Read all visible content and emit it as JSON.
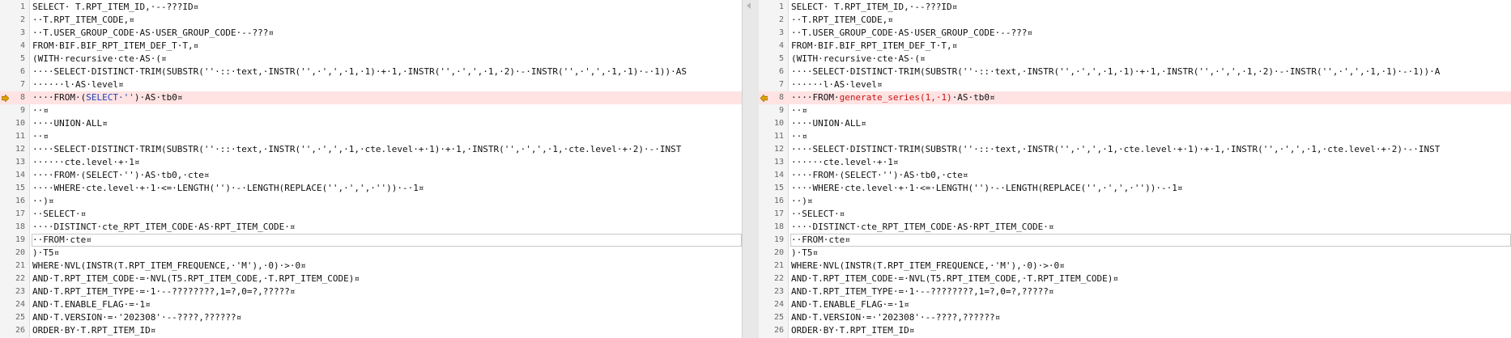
{
  "colors": {
    "changed_line_bg": "#ffe3e3",
    "diff_text_left": "#1f3fb7",
    "diff_text_right": "#cc1111",
    "marker": "#e0a100"
  },
  "icons": {
    "change_marker": "diff-arrow-icon"
  },
  "left": {
    "lines": [
      {
        "n": "1",
        "text": "SELECT· T.RPT_ITEM_ID,·--???ID¤"
      },
      {
        "n": "2",
        "text": "··T.RPT_ITEM_CODE,¤"
      },
      {
        "n": "3",
        "text": "··T.USER_GROUP_CODE·AS·USER_GROUP_CODE·--???¤"
      },
      {
        "n": "4",
        "text": "FROM·BIF.BIF_RPT_ITEM_DEF_T·T,¤"
      },
      {
        "n": "5",
        "text": "(WITH·recursive·cte·AS·(¤"
      },
      {
        "n": "6",
        "text": "····SELECT·DISTINCT·TRIM(SUBSTR(''·::·text,·INSTR('',·',',·1,·1)·+·1,·INSTR('',·',',·1,·2)·-·INSTR('',·',',·1,·1)·-·1))·AS"
      },
      {
        "n": "7",
        "text": "······l·AS·level¤"
      },
      {
        "n": "8",
        "pre": "····FROM·(",
        "hl": "SELECT·''",
        "post": ")·AS·tb0¤",
        "changed": true
      },
      {
        "n": "9",
        "text": "··¤"
      },
      {
        "n": "10",
        "text": "····UNION·ALL¤"
      },
      {
        "n": "11",
        "text": "··¤"
      },
      {
        "n": "12",
        "text": "····SELECT·DISTINCT·TRIM(SUBSTR(''·::·text,·INSTR('',·',',·1,·cte.level·+·1)·+·1,·INSTR('',·',',·1,·cte.level·+·2)·-·INST"
      },
      {
        "n": "13",
        "text": "······cte.level·+·1¤"
      },
      {
        "n": "14",
        "text": "····FROM·(SELECT·'')·AS·tb0,·cte¤"
      },
      {
        "n": "15",
        "text": "····WHERE·cte.level·+·1·<=·LENGTH('')·-·LENGTH(REPLACE('',·',',·''))·-·1¤"
      },
      {
        "n": "16",
        "text": "··)¤"
      },
      {
        "n": "17",
        "text": "··SELECT·¤"
      },
      {
        "n": "18",
        "text": "····DISTINCT·cte_RPT_ITEM_CODE·AS·RPT_ITEM_CODE·¤"
      },
      {
        "n": "19",
        "text": "··FROM·cte¤",
        "boxed": true
      },
      {
        "n": "20",
        "text": ")·T5¤"
      },
      {
        "n": "21",
        "text": "WHERE·NVL(INSTR(T.RPT_ITEM_FREQUENCE,·'M'),·0)·>·0¤"
      },
      {
        "n": "22",
        "text": "AND·T.RPT_ITEM_CODE·=·NVL(T5.RPT_ITEM_CODE,·T.RPT_ITEM_CODE)¤"
      },
      {
        "n": "23",
        "text": "AND·T.RPT_ITEM_TYPE·=·1·--????????,1=?,0=?,?????¤"
      },
      {
        "n": "24",
        "text": "AND·T.ENABLE_FLAG·=·1¤"
      },
      {
        "n": "25",
        "text": "AND·T.VERSION·=·'202308'·--????,??????¤"
      },
      {
        "n": "26",
        "text": "ORDER·BY·T.RPT_ITEM_ID¤"
      }
    ]
  },
  "right": {
    "lines": [
      {
        "n": "1",
        "text": "SELECT· T.RPT_ITEM_ID,·--???ID¤"
      },
      {
        "n": "2",
        "text": "··T.RPT_ITEM_CODE,¤"
      },
      {
        "n": "3",
        "text": "··T.USER_GROUP_CODE·AS·USER_GROUP_CODE·--???¤"
      },
      {
        "n": "4",
        "text": "FROM·BIF.BIF_RPT_ITEM_DEF_T·T,¤"
      },
      {
        "n": "5",
        "text": "(WITH·recursive·cte·AS·(¤"
      },
      {
        "n": "6",
        "text": "····SELECT·DISTINCT·TRIM(SUBSTR(''·::·text,·INSTR('',·',',·1,·1)·+·1,·INSTR('',·',',·1,·2)·-·INSTR('',·',',·1,·1)·-·1))·A"
      },
      {
        "n": "7",
        "text": "······l·AS·level¤"
      },
      {
        "n": "8",
        "pre": "····FROM·",
        "hl": "generate_series(1,·1)",
        "post": "·AS·tb0¤",
        "changed": true
      },
      {
        "n": "9",
        "text": "··¤"
      },
      {
        "n": "10",
        "text": "····UNION·ALL¤"
      },
      {
        "n": "11",
        "text": "··¤"
      },
      {
        "n": "12",
        "text": "····SELECT·DISTINCT·TRIM(SUBSTR(''·::·text,·INSTR('',·',',·1,·cte.level·+·1)·+·1,·INSTR('',·',',·1,·cte.level·+·2)·-·INST"
      },
      {
        "n": "13",
        "text": "······cte.level·+·1¤"
      },
      {
        "n": "14",
        "text": "····FROM·(SELECT·'')·AS·tb0,·cte¤"
      },
      {
        "n": "15",
        "text": "····WHERE·cte.level·+·1·<=·LENGTH('')·-·LENGTH(REPLACE('',·',',·''))·-·1¤"
      },
      {
        "n": "16",
        "text": "··)¤"
      },
      {
        "n": "17",
        "text": "··SELECT·¤"
      },
      {
        "n": "18",
        "text": "····DISTINCT·cte_RPT_ITEM_CODE·AS·RPT_ITEM_CODE·¤"
      },
      {
        "n": "19",
        "text": "··FROM·cte¤",
        "boxed": true
      },
      {
        "n": "20",
        "text": ")·T5¤"
      },
      {
        "n": "21",
        "text": "WHERE·NVL(INSTR(T.RPT_ITEM_FREQUENCE,·'M'),·0)·>·0¤"
      },
      {
        "n": "22",
        "text": "AND·T.RPT_ITEM_CODE·=·NVL(T5.RPT_ITEM_CODE,·T.RPT_ITEM_CODE)¤"
      },
      {
        "n": "23",
        "text": "AND·T.RPT_ITEM_TYPE·=·1·--????????,1=?,0=?,?????¤"
      },
      {
        "n": "24",
        "text": "AND·T.ENABLE_FLAG·=·1¤"
      },
      {
        "n": "25",
        "text": "AND·T.VERSION·=·'202308'·--????,??????¤"
      },
      {
        "n": "26",
        "text": "ORDER·BY·T.RPT_ITEM_ID¤"
      }
    ]
  }
}
